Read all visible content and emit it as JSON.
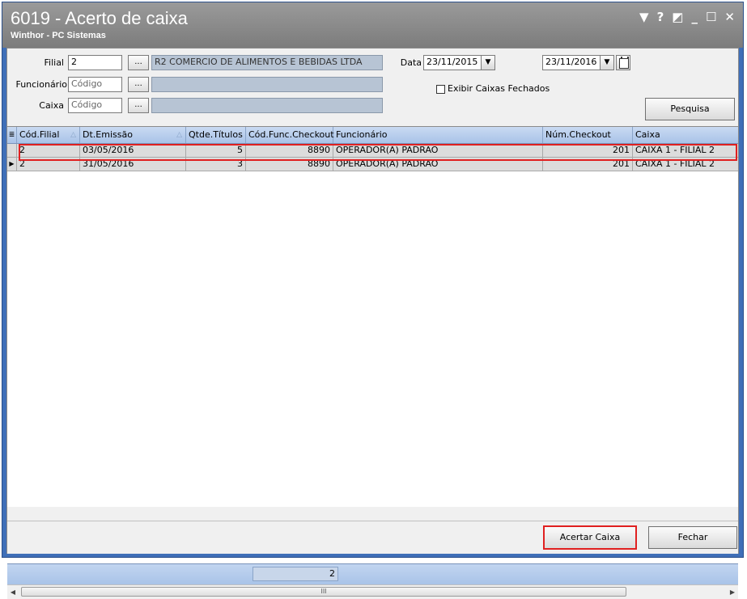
{
  "window": {
    "title": "6019 - Acerto de caixa",
    "subtitle": "Winthor - PC Sistemas",
    "controls": [
      "▼",
      "?",
      "◩",
      "_",
      "☐",
      "✕"
    ]
  },
  "filters": {
    "filial_label": "Filial",
    "filial_value": "2",
    "filial_name": "R2 COMERCIO DE ALIMENTOS E BEBIDAS LTDA",
    "funcionario_label": "Funcionário",
    "funcionario_placeholder": "Código",
    "caixa_label": "Caixa",
    "caixa_placeholder": "Código",
    "lookup_button": "...",
    "data_label": "Data",
    "data_inicio": "23/11/2015",
    "data_fim": "23/11/2016",
    "exibir_fechados_label": "Exibir Caixas Fechados",
    "pesquisa_button": "Pesquisa"
  },
  "grid": {
    "columns": [
      "Cód.Filial",
      "Dt.Emissão",
      "Qtde.Títulos",
      "Cód.Func.Checkout",
      "Funcionário",
      "Núm.Checkout",
      "Caixa"
    ],
    "rows": [
      [
        "2",
        "03/05/2016",
        "5",
        "8890",
        "OPERADOR(A) PADRAO",
        "201",
        "CAIXA 1 - FILIAL 2"
      ],
      [
        "2",
        "31/05/2016",
        "3",
        "8890",
        "OPERADOR(A) PADRAO",
        "201",
        "CAIXA 1 - FILIAL 2"
      ]
    ],
    "footer_total": "2",
    "scroll_grip": "III"
  },
  "actions": {
    "acertar_caixa": "Acertar Caixa",
    "fechar": "Fechar"
  },
  "colors": {
    "title_bg": "#8a8a8a",
    "window_border": "#3f6fb8",
    "header_bg": "#b6cdec",
    "highlight": "#e02020"
  }
}
